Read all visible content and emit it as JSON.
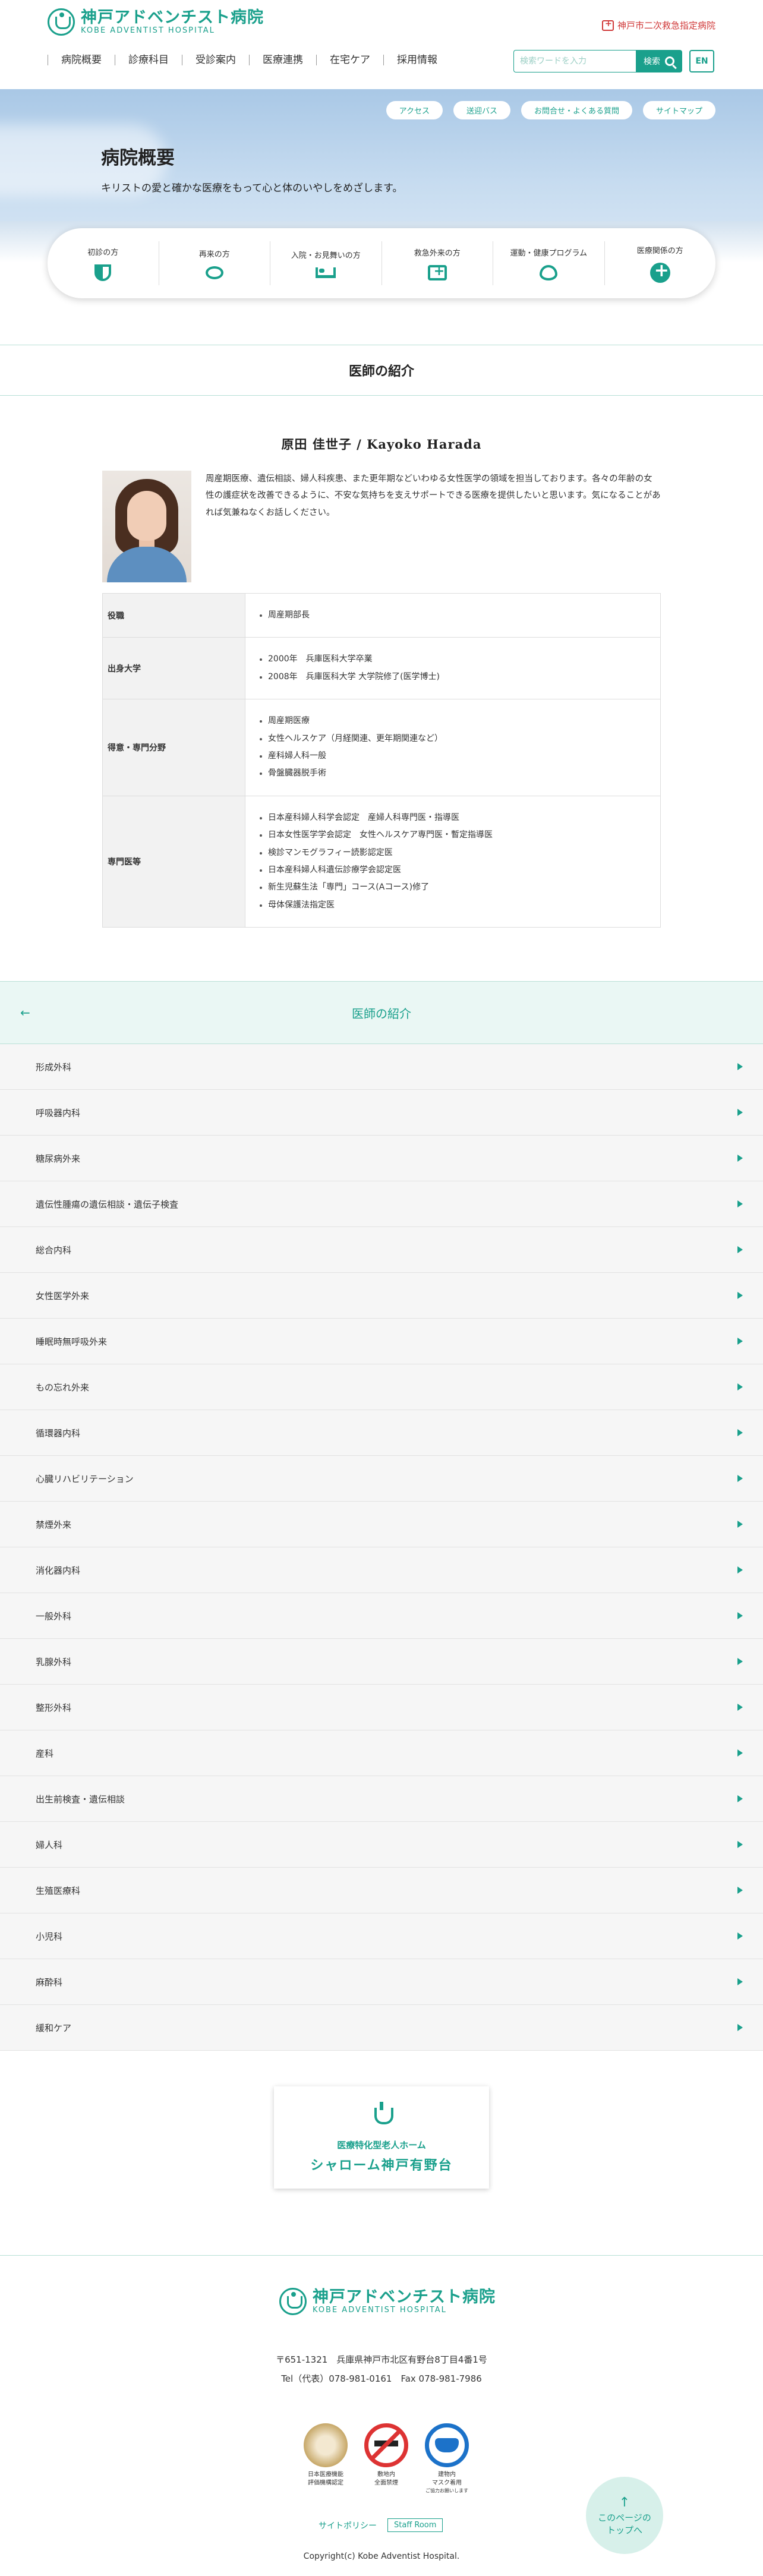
{
  "header": {
    "logo_ja": "神戸アドベンチスト病院",
    "logo_en": "KOBE ADVENTIST HOSPITAL",
    "emergency": "神戸市二次救急指定病院",
    "nav": [
      "病院概要",
      "診療科目",
      "受診案内",
      "医療連携",
      "在宅ケア",
      "採用情報"
    ],
    "search_placeholder": "検索ワードを入力",
    "search_button": "検索",
    "lang_button": "EN"
  },
  "hero": {
    "subnav": [
      "アクセス",
      "送迎バス",
      "お問合せ・よくある質問",
      "サイトマップ"
    ],
    "title": "病院概要",
    "lead": "キリストの愛と確かな医療をもって心と体のいやしをめざします。",
    "quick_links": [
      "初診の方",
      "再来の方",
      "入院・お見舞いの方",
      "救急外来の方",
      "運動・健康プログラム",
      "医療関係の方"
    ]
  },
  "section_title": "医師の紹介",
  "doctor": {
    "name": "原田 佳世子 / Kayoko Harada",
    "intro": "周産期医療、遺伝相談、婦人科疾患、また更年期などいわゆる女性医学の領域を担当しております。各々の年齢の女性の護症状を改善できるように、不安な気持ちを支えサポートできる医療を提供したいと思います。気になることがあれば気兼ねなくお話しください。",
    "rows": [
      {
        "label": "役職",
        "items": [
          "周産期部長"
        ]
      },
      {
        "label": "出身大学",
        "items": [
          "2000年　兵庫医科大学卒業",
          "2008年　兵庫医科大学 大学院修了(医学博士)"
        ]
      },
      {
        "label": "得意・専門分野",
        "items": [
          "周産期医療",
          "女性ヘルスケア（月経関連、更年期関連など）",
          "産科婦人科一般",
          "骨盤臓器脱手術"
        ]
      },
      {
        "label": "専門医等",
        "items": [
          "日本産科婦人科学会認定　産婦人科専門医・指導医",
          "日本女性医学学会認定　女性ヘルスケア専門医・暫定指導医",
          "検診マンモグラフィー読影認定医",
          "日本産科婦人科遺伝診療学会認定医",
          "新生児蘇生法「専門」コース(Aコース)修了",
          "母体保護法指定医"
        ]
      }
    ]
  },
  "departments": {
    "title": "医師の紹介",
    "back": "←",
    "items": [
      "形成外科",
      "呼吸器内科",
      "糖尿病外来",
      "遺伝性腫瘍の遺伝相談・遺伝子検査",
      "総合内科",
      "女性医学外来",
      "睡眠時無呼吸外来",
      "もの忘れ外来",
      "循環器内科",
      "心臓リハビリテーション",
      "禁煙外来",
      "消化器内科",
      "一般外科",
      "乳腺外科",
      "整形外科",
      "産科",
      "出生前検査・遺伝相談",
      "婦人科",
      "生殖医療科",
      "小児科",
      "麻酔科",
      "緩和ケア"
    ]
  },
  "banner": {
    "line1": "医療特化型老人ホーム",
    "line2": "シャローム神戸有野台"
  },
  "footer": {
    "logo_ja": "神戸アドベンチスト病院",
    "logo_en": "KOBE ADVENTIST HOSPITAL",
    "address": "〒651-1321　兵庫県神戸市北区有野台8丁目4番1号",
    "tel": "Tel（代表）078-981-0161　Fax 078-981-7986",
    "badges": [
      {
        "icon": "accreditation-icon",
        "text1": "日本医療機能",
        "text2": "評価機構認定",
        "text3": ""
      },
      {
        "icon": "no-smoking-icon",
        "text1": "敷地内",
        "text2": "全面禁煙",
        "text3": ""
      },
      {
        "icon": "mask-icon",
        "text1": "建物内",
        "text2": "マスク着用",
        "text3": "ご協力お願いします"
      }
    ],
    "policy": "サイトポリシー",
    "staff_room": "Staff Room",
    "copyright": "Copyright(c) Kobe Adventist Hospital.",
    "to_top_1": "このページの",
    "to_top_2": "トップへ",
    "to_top_arrow": "↑"
  }
}
